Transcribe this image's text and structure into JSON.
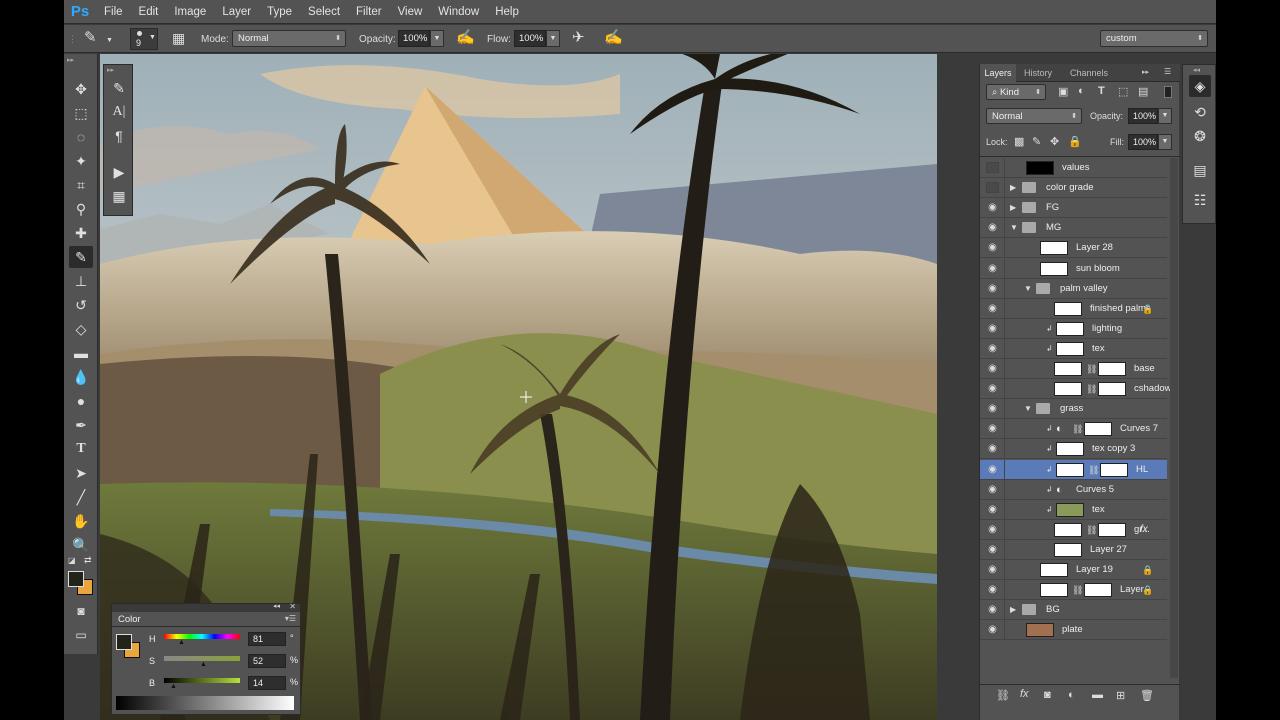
{
  "menu": [
    "File",
    "Edit",
    "Image",
    "Layer",
    "Type",
    "Select",
    "Filter",
    "View",
    "Window",
    "Help"
  ],
  "app_logo": "Ps",
  "options": {
    "brush_size": "9",
    "mode_label": "Mode:",
    "mode_value": "Normal",
    "opacity_label": "Opacity:",
    "opacity_value": "100%",
    "flow_label": "Flow:",
    "flow_value": "100%",
    "workspace": "custom"
  },
  "color_panel": {
    "title": "Color",
    "h_label": "H",
    "h_value": "81",
    "h_unit": "°",
    "s_label": "S",
    "s_value": "52",
    "s_unit": "%",
    "b_label": "B",
    "b_value": "14",
    "b_unit": "%"
  },
  "layers_panel": {
    "tabs": [
      "Layers",
      "History",
      "Channels"
    ],
    "filter_label": "Kind",
    "blend_mode": "Normal",
    "opacity_label": "Opacity:",
    "opacity_value": "100%",
    "lock_label": "Lock:",
    "fill_label": "Fill:",
    "fill_value": "100%",
    "layers": [
      {
        "name": "values",
        "indent": 0,
        "type": "layer",
        "visible": false,
        "thumb": "#000000"
      },
      {
        "name": "color grade",
        "indent": 0,
        "type": "group",
        "expanded": false,
        "visible": false
      },
      {
        "name": "FG",
        "indent": 0,
        "type": "group",
        "expanded": false,
        "visible": true
      },
      {
        "name": "MG",
        "indent": 0,
        "type": "group",
        "expanded": true,
        "visible": true
      },
      {
        "name": "Layer 28",
        "indent": 1,
        "type": "layer",
        "visible": true,
        "thumb": "#ffffff"
      },
      {
        "name": "sun bloom",
        "indent": 1,
        "type": "layer",
        "visible": true,
        "thumb": "#ffffff"
      },
      {
        "name": "palm valley",
        "indent": 1,
        "type": "group",
        "expanded": true,
        "visible": true
      },
      {
        "name": "finished palms",
        "indent": 2,
        "type": "layer",
        "visible": true,
        "thumb": "#ffffff",
        "locked": true
      },
      {
        "name": "lighting",
        "indent": 2,
        "type": "layer",
        "visible": true,
        "thumb": "#ffffff",
        "clip": true
      },
      {
        "name": "tex",
        "indent": 2,
        "type": "layer",
        "visible": true,
        "thumb": "#ffffff",
        "clip": true
      },
      {
        "name": "base",
        "indent": 2,
        "type": "layer",
        "visible": true,
        "thumb": "#ffffff",
        "mask": true
      },
      {
        "name": "cshadow",
        "indent": 2,
        "type": "layer",
        "visible": true,
        "thumb": "#ffffff",
        "mask": true
      },
      {
        "name": "grass",
        "indent": 1,
        "type": "group",
        "expanded": true,
        "visible": true
      },
      {
        "name": "Curves 7",
        "indent": 2,
        "type": "adjust",
        "visible": true,
        "mask": true,
        "clip": true
      },
      {
        "name": "tex copy 3",
        "indent": 2,
        "type": "layer",
        "visible": true,
        "thumb": "#ffffff",
        "clip": true
      },
      {
        "name": "HL",
        "indent": 2,
        "type": "layer",
        "visible": true,
        "thumb": "#ffffff",
        "mask": true,
        "clip": true,
        "selected": true
      },
      {
        "name": "Curves 5",
        "indent": 2,
        "type": "adjust",
        "visible": true,
        "clip": true
      },
      {
        "name": "tex",
        "indent": 2,
        "type": "layer",
        "visible": true,
        "thumb": "#8a9a5a",
        "clip": true
      },
      {
        "name": "gr...",
        "indent": 2,
        "type": "layer",
        "visible": true,
        "thumb": "#ffffff",
        "mask": true,
        "fx": true
      },
      {
        "name": "Layer 27",
        "indent": 2,
        "type": "layer",
        "visible": true,
        "thumb": "#ffffff"
      },
      {
        "name": "Layer 19",
        "indent": 1,
        "type": "layer",
        "visible": true,
        "thumb": "#ffffff",
        "locked": true
      },
      {
        "name": "Layer...",
        "indent": 1,
        "type": "layer",
        "visible": true,
        "thumb": "#ffffff",
        "mask": true,
        "locked": true
      },
      {
        "name": "BG",
        "indent": 0,
        "type": "group",
        "expanded": false,
        "visible": true
      },
      {
        "name": "plate",
        "indent": 0,
        "type": "layer",
        "visible": true,
        "thumb": "#a07050"
      }
    ]
  }
}
